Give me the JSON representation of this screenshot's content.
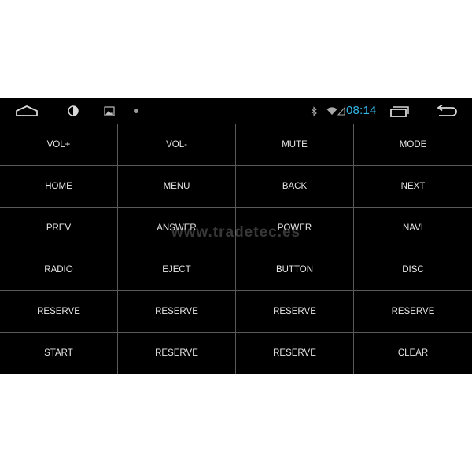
{
  "status_bar": {
    "time": "08:14",
    "icons": {
      "back_nav": "nav-back-icon",
      "brightness": "brightness-icon",
      "gallery": "image-icon",
      "notification": "dot-icon",
      "bluetooth": "bluetooth-icon",
      "wifi": "wifi-icon",
      "signal": "signal-icon",
      "recents": "recent-apps-icon",
      "return": "return-icon"
    },
    "clock_color": "#33b5e5"
  },
  "keys": [
    "VOL+",
    "VOL-",
    "MUTE",
    "MODE",
    "HOME",
    "MENU",
    "BACK",
    "NEXT",
    "PREV",
    "ANSWER",
    "POWER",
    "NAVI",
    "RADIO",
    "EJECT",
    "BUTTON",
    "DISC",
    "RESERVE",
    "RESERVE",
    "RESERVE",
    "RESERVE",
    "START",
    "RESERVE",
    "RESERVE",
    "CLEAR"
  ],
  "watermark": "www.tradetec.es"
}
